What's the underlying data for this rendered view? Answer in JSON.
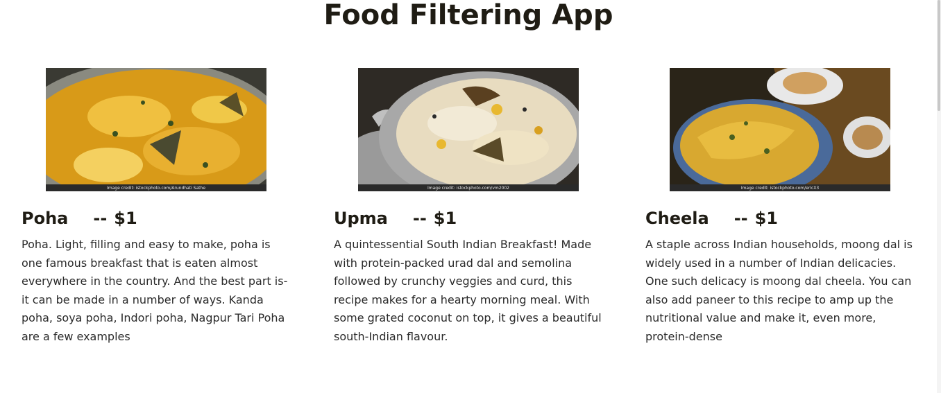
{
  "app": {
    "title": "Food Filtering App"
  },
  "items": [
    {
      "name": "Poha",
      "separator": "--",
      "price": "$1",
      "image_credit": "Image credit: istockphoto.com/Arundhati Sathe",
      "description": "Poha. Light, filling and easy to make, poha is one famous breakfast that is eaten almost everywhere in the country. And the best part is- it can be made in a number of ways. Kanda poha, soya poha, Indori poha, Nagpur Tari Poha are a few examples"
    },
    {
      "name": "Upma",
      "separator": "--",
      "price": "$1",
      "image_credit": "Image credit: istockphoto.com/vm2002",
      "description": "A quintessential South Indian Breakfast! Made with protein-packed urad dal and semolina followed by crunchy veggies and curd, this recipe makes for a hearty morning meal. With some grated coconut on top, it gives a beautiful south-Indian flavour."
    },
    {
      "name": "Cheela",
      "separator": "--",
      "price": "$1",
      "image_credit": "Image credit: istockphoto.com/ericX3",
      "description": "A staple across Indian households, moong dal is widely used in a number of Indian delicacies. One such delicacy is moong dal cheela. You can also add paneer to this recipe to amp up the nutritional value and make it, even more, protein-dense"
    }
  ]
}
